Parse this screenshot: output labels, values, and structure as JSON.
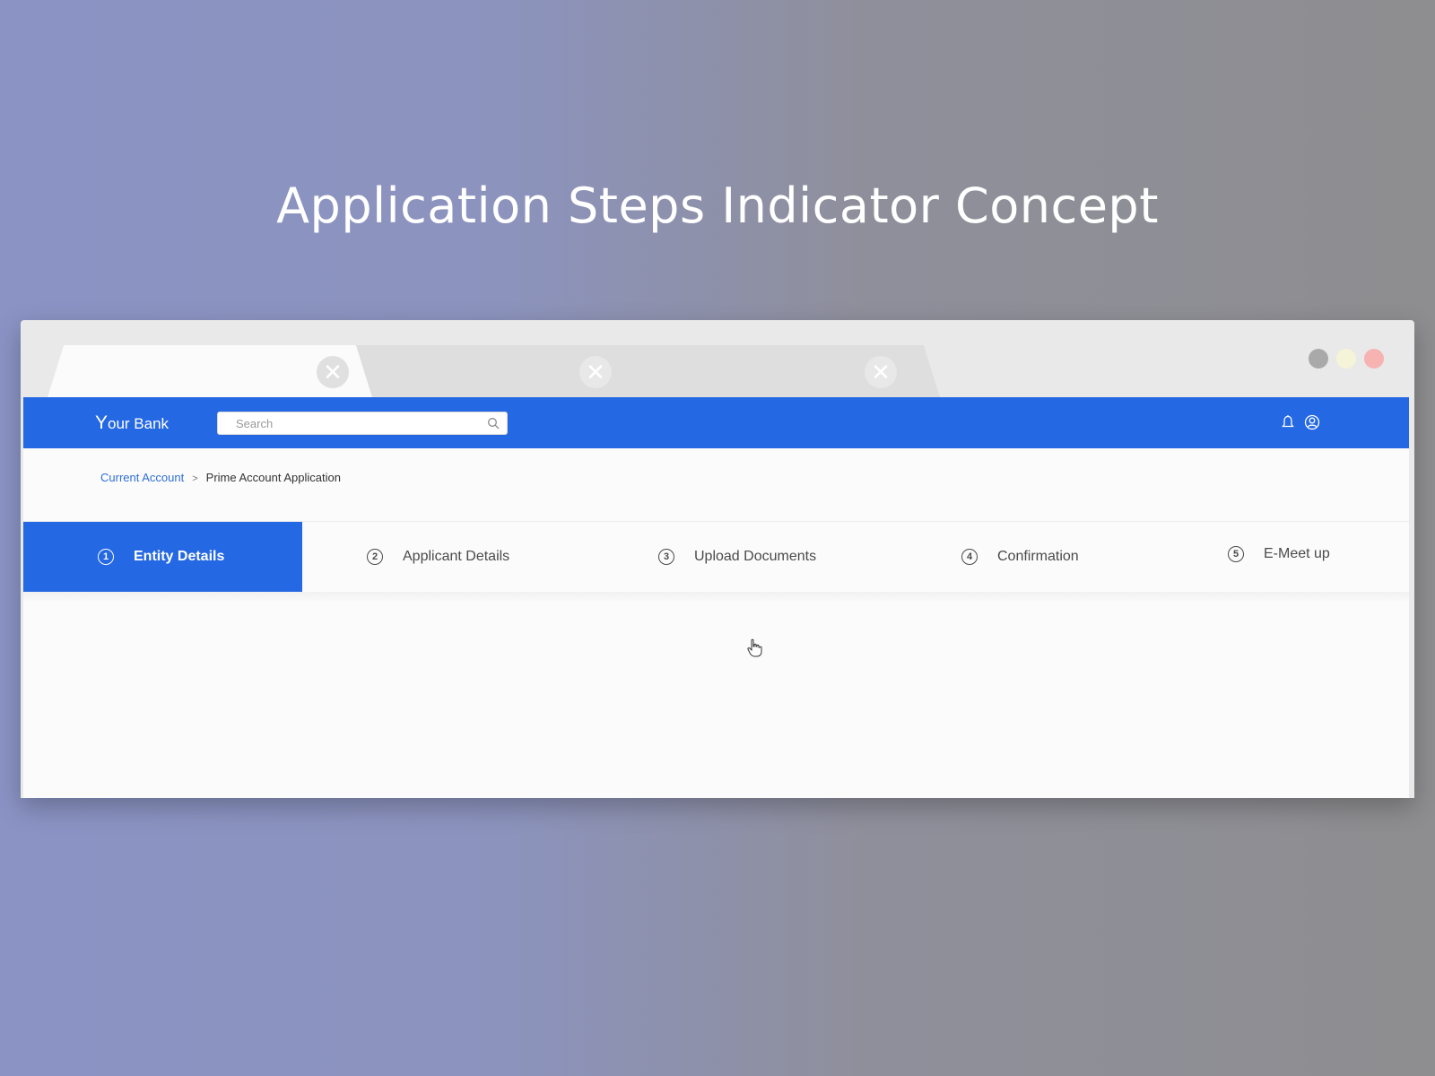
{
  "headline": "Application Steps Indicator Concept",
  "browser": {
    "tabs": [
      {
        "active": true,
        "close_icon": "close-icon"
      },
      {
        "active": false,
        "close_icon": "close-icon"
      },
      {
        "active": false,
        "close_icon": "close-icon"
      }
    ],
    "close_glyph": "✕",
    "window_controls": {
      "minimize": "#a9a9a9",
      "maximize": "#f6f4d8",
      "close": "#f7b2b2"
    }
  },
  "navbar": {
    "brand_initial": "Y",
    "brand_rest": "our Bank",
    "search": {
      "placeholder": "Search",
      "value": ""
    },
    "icons": [
      "bell-icon",
      "user-icon"
    ],
    "color": "#2568e3"
  },
  "breadcrumb": {
    "items": [
      "Current Account",
      "Prime Account Application"
    ],
    "separator": ">"
  },
  "steps": [
    {
      "number": "1",
      "label": "Entity Details",
      "active": true
    },
    {
      "number": "2",
      "label": "Applicant Details",
      "active": false
    },
    {
      "number": "3",
      "label": "Upload Documents",
      "active": false
    },
    {
      "number": "4",
      "label": "Confirmation",
      "active": false
    },
    {
      "number": "5",
      "label": "E-Meet up",
      "active": false
    }
  ]
}
